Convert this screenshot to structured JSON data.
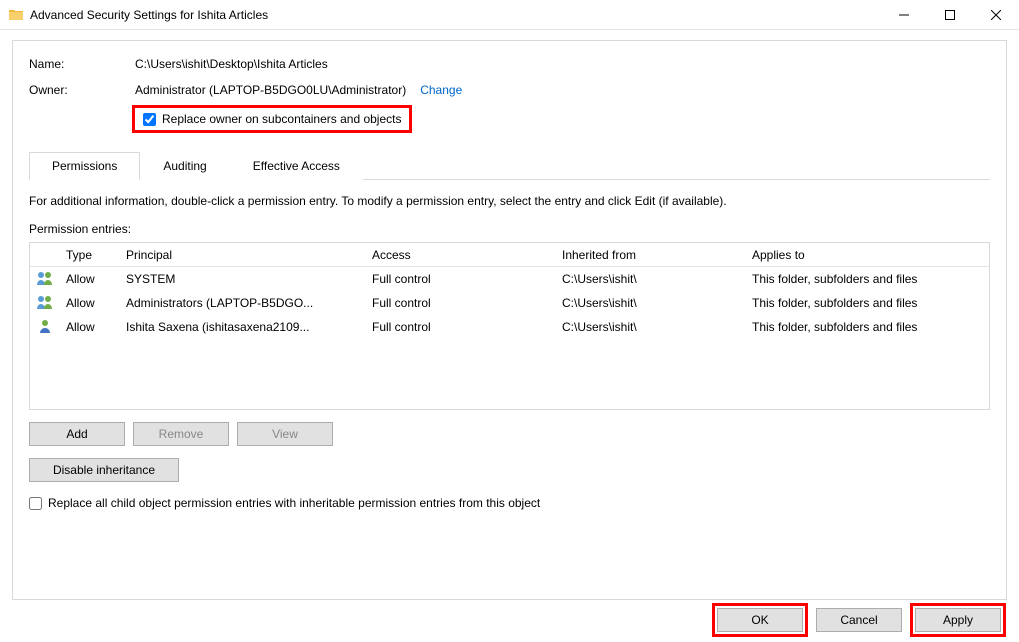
{
  "window": {
    "title": "Advanced Security Settings for Ishita Articles"
  },
  "fields": {
    "name_label": "Name:",
    "name_value": "C:\\Users\\ishit\\Desktop\\Ishita Articles",
    "owner_label": "Owner:",
    "owner_value": "Administrator (LAPTOP-B5DGO0LU\\Administrator)",
    "change_link": "Change",
    "replace_owner_label": "Replace owner on subcontainers and objects"
  },
  "tabs": {
    "permissions": "Permissions",
    "auditing": "Auditing",
    "effective_access": "Effective Access"
  },
  "content": {
    "info_text": "For additional information, double-click a permission entry. To modify a permission entry, select the entry and click Edit (if available).",
    "entries_label": "Permission entries:"
  },
  "table": {
    "headers": {
      "type": "Type",
      "principal": "Principal",
      "access": "Access",
      "inherited": "Inherited from",
      "applies": "Applies to"
    },
    "rows": [
      {
        "type": "Allow",
        "principal": "SYSTEM",
        "access": "Full control",
        "inherited": "C:\\Users\\ishit\\",
        "applies": "This folder, subfolders and files"
      },
      {
        "type": "Allow",
        "principal": "Administrators (LAPTOP-B5DGO...",
        "access": "Full control",
        "inherited": "C:\\Users\\ishit\\",
        "applies": "This folder, subfolders and files"
      },
      {
        "type": "Allow",
        "principal": "Ishita Saxena (ishitasaxena2109...",
        "access": "Full control",
        "inherited": "C:\\Users\\ishit\\",
        "applies": "This folder, subfolders and files"
      }
    ]
  },
  "buttons": {
    "add": "Add",
    "remove": "Remove",
    "view": "View",
    "disable_inheritance": "Disable inheritance",
    "replace_child_label": "Replace all child object permission entries with inheritable permission entries from this object",
    "ok": "OK",
    "cancel": "Cancel",
    "apply": "Apply"
  }
}
